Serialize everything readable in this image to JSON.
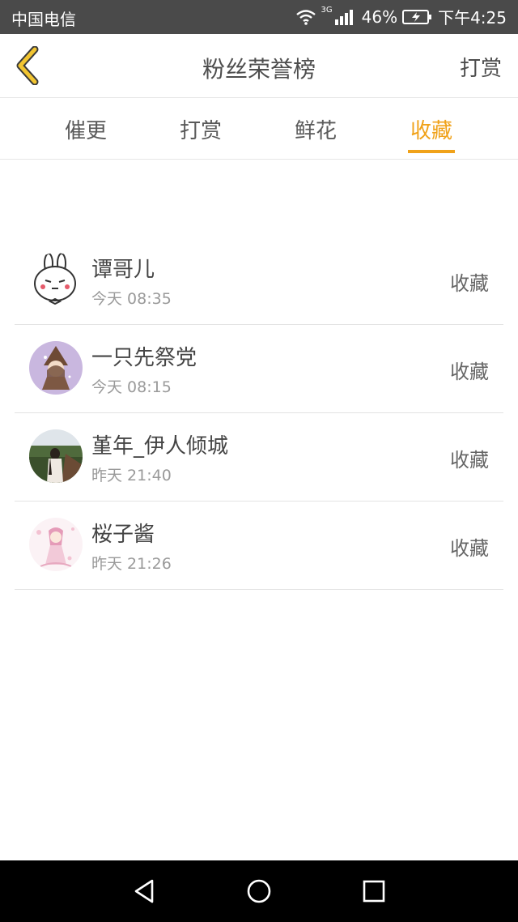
{
  "status_bar": {
    "carrier": "中国电信",
    "network_type": "3G",
    "battery": "46%",
    "time": "下午4:25"
  },
  "header": {
    "title": "粉丝荣誉榜",
    "right_link": "打赏",
    "back_icon": "chevron-left-icon"
  },
  "tabs": [
    {
      "label": "催更",
      "active": false
    },
    {
      "label": "打赏",
      "active": false
    },
    {
      "label": "鲜花",
      "active": false
    },
    {
      "label": "收藏",
      "active": true
    }
  ],
  "colors": {
    "accent": "#f0a21a",
    "status_bar_bg": "#4a4a4a",
    "nav_bar_bg": "#000000"
  },
  "list": [
    {
      "name": "谭哥儿",
      "time": "今天 08:35",
      "action": "收藏",
      "avatar": "bunny-avatar"
    },
    {
      "name": "一只先祭党",
      "time": "今天 08:15",
      "action": "收藏",
      "avatar": "witch-girl-avatar"
    },
    {
      "name": "堇年_伊人倾城",
      "time": "昨天 21:40",
      "action": "收藏",
      "avatar": "photo-girl-avatar"
    },
    {
      "name": "桜子酱",
      "time": "昨天 21:26",
      "action": "收藏",
      "avatar": "anime-girl-avatar"
    }
  ],
  "nav_bar": {
    "back": "triangle-back-icon",
    "home": "circle-home-icon",
    "recent": "square-recent-icon"
  }
}
